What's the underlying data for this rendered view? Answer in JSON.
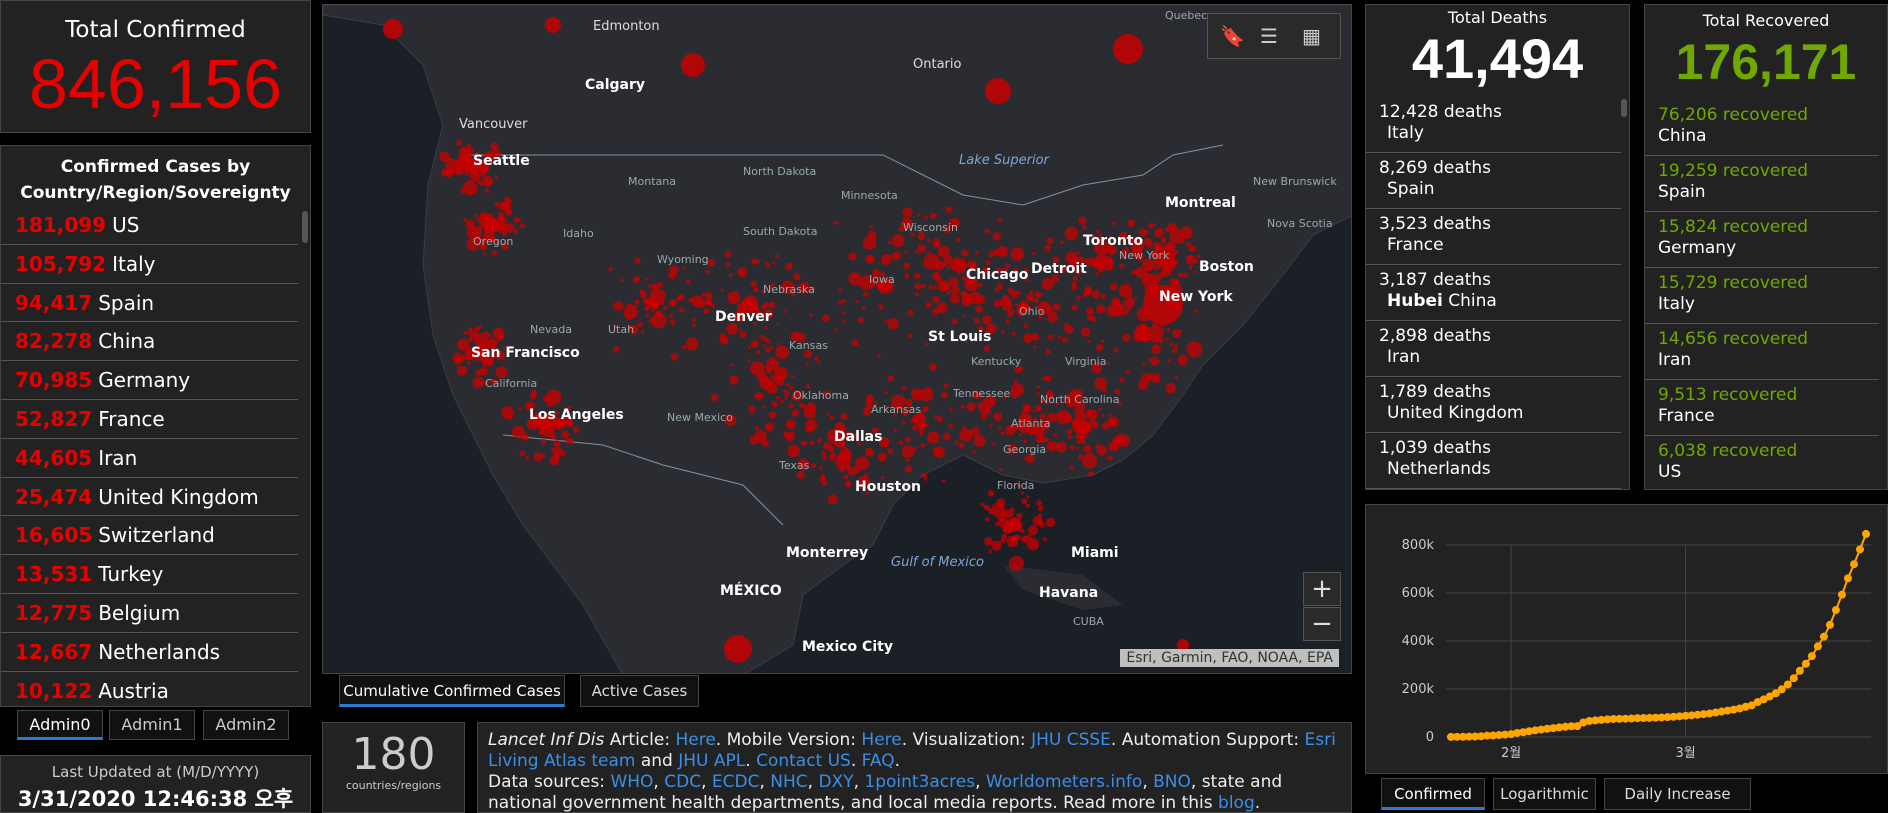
{
  "total_confirmed": {
    "label": "Total Confirmed",
    "value": "846,156"
  },
  "country_list": {
    "header": "Confirmed Cases by Country/Region/Sovereignty",
    "items": [
      {
        "value": "181,099",
        "name": "US"
      },
      {
        "value": "105,792",
        "name": "Italy"
      },
      {
        "value": "94,417",
        "name": "Spain"
      },
      {
        "value": "82,278",
        "name": "China"
      },
      {
        "value": "70,985",
        "name": "Germany"
      },
      {
        "value": "52,827",
        "name": "France"
      },
      {
        "value": "44,605",
        "name": "Iran"
      },
      {
        "value": "25,474",
        "name": "United Kingdom"
      },
      {
        "value": "16,605",
        "name": "Switzerland"
      },
      {
        "value": "13,531",
        "name": "Turkey"
      },
      {
        "value": "12,775",
        "name": "Belgium"
      },
      {
        "value": "12,667",
        "name": "Netherlands"
      },
      {
        "value": "10,122",
        "name": "Austria"
      }
    ]
  },
  "admin_tabs": [
    "Admin0",
    "Admin1",
    "Admin2"
  ],
  "last_updated": {
    "label": "Last Updated at (M/D/YYYY)",
    "value": "3/31/2020 12:46:38 오후"
  },
  "map": {
    "attribution": "Esri, Garmin, FAO, NOAA, EPA",
    "zoom_in": "+",
    "zoom_out": "−",
    "labels": {
      "edmonton": "Edmonton",
      "calgary": "Calgary",
      "vancouver": "Vancouver",
      "seattle": "Seattle",
      "ontario": "Ontario",
      "quebec": "Quebec",
      "lake_superior": "Lake Superior",
      "montana": "Montana",
      "north_dakota": "North Dakota",
      "minnesota": "Minnesota",
      "wisconsin": "Wisconsin",
      "montreal": "Montreal",
      "new_brunswick": "New Brunswick",
      "nova_scotia": "Nova Scotia",
      "idaho": "Idaho",
      "oregon": "Oregon",
      "south_dakota": "South Dakota",
      "toronto": "Toronto",
      "wyoming": "Wyoming",
      "detroit": "Detroit",
      "chicago": "Chicago",
      "new_york_state": "New York",
      "boston": "Boston",
      "iowa": "Iowa",
      "nebraska": "Nebraska",
      "new_york": "New York",
      "nevada": "Nevada",
      "utah": "Utah",
      "denver": "Denver",
      "ohio": "Ohio",
      "san_francisco": "San Francisco",
      "california": "California",
      "st_louis": "St Louis",
      "kansas": "Kansas",
      "kentucky": "Kentucky",
      "virginia": "Virginia",
      "oklahoma": "Oklahoma",
      "north_carolina": "North Carolina",
      "tennessee": "Tennessee",
      "los_angeles": "Los Angeles",
      "arkansas": "Arkansas",
      "new_mexico": "New Mexico",
      "atlanta": "Atlanta",
      "dallas": "Dallas",
      "georgia": "Georgia",
      "texas": "Texas",
      "houston": "Houston",
      "florida": "Florida",
      "miami": "Miami",
      "monterrey": "Monterrey",
      "gulf": "Gulf of Mexico",
      "mexico": "MÉXICO",
      "havana": "Havana",
      "cuba": "CUBA",
      "mexico_city": "Mexico City"
    }
  },
  "map_tabs": [
    "Cumulative Confirmed Cases",
    "Active Cases"
  ],
  "countries_count": {
    "value": "180",
    "label": "countries/regions"
  },
  "info": {
    "journal": "Lancet Inf Dis",
    "t1": " Article: ",
    "l_here1": "Here",
    "t2": ". Mobile Version: ",
    "l_here2": "Here",
    "t3": ". Visualization: ",
    "l_jhu": "JHU CSSE",
    "t4": ". Automation Support: ",
    "l_esri": "Esri Living Atlas team",
    "t5": " and ",
    "l_apl": "JHU APL",
    "t6": ". ",
    "l_contact": "Contact US",
    "t7": ". ",
    "l_faq": "FAQ",
    "t8": ".",
    "t9": "Data sources: ",
    "l_who": "WHO",
    "c1": ", ",
    "l_cdc": "CDC",
    "c2": ", ",
    "l_ecdc": "ECDC",
    "c3": ", ",
    "l_nhc": "NHC",
    "c4": ", ",
    "l_dxy": "DXY",
    "c5": ", ",
    "l_1p3a": "1point3acres",
    "c6": ", ",
    "l_wom": "Worldometers.info",
    "c7": ", ",
    "l_bno": "BNO",
    "t10": ", state and national government health departments, and local media reports.  Read more in this ",
    "l_blog": "blog",
    "t11": "."
  },
  "total_deaths": {
    "label": "Total Deaths",
    "value": "41,494",
    "items": [
      {
        "value": "12,428",
        "unit": "deaths",
        "place": "Italy",
        "prefix": ""
      },
      {
        "value": "8,269",
        "unit": "deaths",
        "place": "Spain",
        "prefix": ""
      },
      {
        "value": "3,523",
        "unit": "deaths",
        "place": "France",
        "prefix": ""
      },
      {
        "value": "3,187",
        "unit": "deaths",
        "place": "China",
        "prefix": "Hubei"
      },
      {
        "value": "2,898",
        "unit": "deaths",
        "place": "Iran",
        "prefix": ""
      },
      {
        "value": "1,789",
        "unit": "deaths",
        "place": "United Kingdom",
        "prefix": ""
      },
      {
        "value": "1,039",
        "unit": "deaths",
        "place": "Netherlands",
        "prefix": ""
      }
    ]
  },
  "total_recovered": {
    "label": "Total Recovered",
    "value": "176,171",
    "items": [
      {
        "value": "76,206",
        "unit": "recovered",
        "place": "China"
      },
      {
        "value": "19,259",
        "unit": "recovered",
        "place": "Spain"
      },
      {
        "value": "15,824",
        "unit": "recovered",
        "place": "Germany"
      },
      {
        "value": "15,729",
        "unit": "recovered",
        "place": "Italy"
      },
      {
        "value": "14,656",
        "unit": "recovered",
        "place": "Iran"
      },
      {
        "value": "9,513",
        "unit": "recovered",
        "place": "France"
      },
      {
        "value": "6,038",
        "unit": "recovered",
        "place": "US"
      }
    ]
  },
  "chart_tabs": [
    "Confirmed",
    "Logarithmic",
    "Daily Increase"
  ],
  "chart_data": {
    "type": "line",
    "title": "",
    "xlabel": "",
    "ylabel": "",
    "y_ticks": [
      "0",
      "200k",
      "400k",
      "600k",
      "800k"
    ],
    "x_ticks": [
      "2월",
      "3월"
    ],
    "ylim": [
      0,
      800000
    ],
    "grid": true,
    "color": "#ffa500",
    "values": [
      555,
      654,
      941,
      1434,
      2118,
      2927,
      5578,
      6166,
      8234,
      9927,
      12038,
      16787,
      19887,
      23898,
      27643,
      30802,
      34395,
      37129,
      40160,
      42768,
      44810,
      45228,
      60370,
      66887,
      69032,
      71226,
      73260,
      75138,
      75641,
      76199,
      76843,
      78599,
      78985,
      79570,
      80415,
      81397,
      82756,
      84124,
      86013,
      88371,
      90309,
      92844,
      95124,
      98124,
      102000,
      106000,
      110000,
      114000,
      119000,
      126000,
      132000,
      146000,
      157000,
      169000,
      182000,
      199000,
      219000,
      245000,
      276000,
      305000,
      337000,
      378000,
      418000,
      467000,
      529000,
      593000,
      661000,
      720000,
      782000,
      846156
    ]
  }
}
